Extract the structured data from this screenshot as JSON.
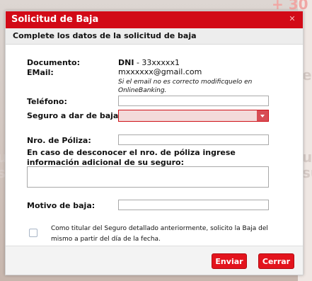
{
  "background": {
    "fragments": [
      "+ 30",
      "et",
      "ur",
      "su",
      "ur",
      "su"
    ]
  },
  "dialog": {
    "title": "Solicitud de Baja",
    "close_icon": "close-icon",
    "subheader": "Complete los datos de la solicitud de baja"
  },
  "form": {
    "documento_label": "Documento:",
    "documento_type": "DNI",
    "documento_value": "- 33xxxxx1",
    "email_label": "EMail:",
    "email_value": "mxxxxxx@gmail.com",
    "email_note": "Si el email no es correcto modificquelo en OnlineBanking.",
    "telefono_label": "Teléfono:",
    "telefono_value": "",
    "seguro_label": "Seguro a dar de baja:",
    "seguro_value": "",
    "poliza_label": "Nro. de Póliza:",
    "poliza_value": "",
    "info_label": "En caso de desconocer el nro. de póliza ingrese información adicional de su seguro:",
    "info_value": "",
    "motivo_label": "Motivo de baja:",
    "motivo_value": "",
    "consent_text": "Como titular del Seguro detallado anteriormente, solicito la Baja del mismo a partir del día de la fecha.",
    "consent_checked": false
  },
  "footer": {
    "enviar_label": "Enviar",
    "cerrar_label": "Cerrar"
  },
  "colors": {
    "accent": "#d20a17",
    "button": "#e3141d"
  }
}
